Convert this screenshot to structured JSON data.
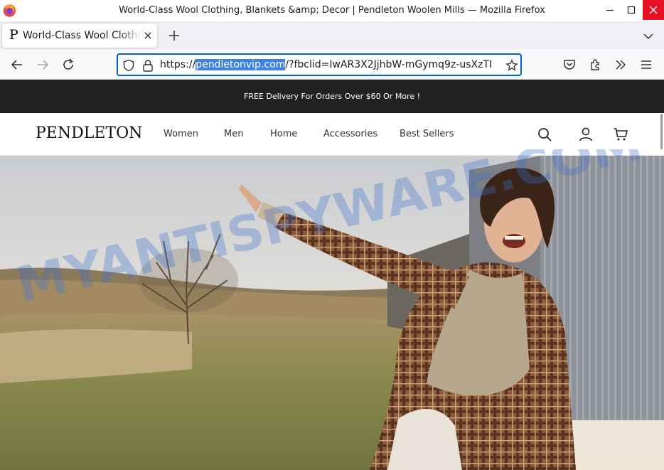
{
  "window": {
    "title": "World-Class Wool Clothing, Blankets &amp; Decor | Pendleton Woolen Mills — Mozilla Firefox"
  },
  "tab": {
    "favicon": "P",
    "title": "World-Class Wool Clothing, Blankets & Decor | Pendleton Woolen Mills"
  },
  "urlbar": {
    "prefix": "https://",
    "domain": "pendletonvip.com",
    "suffix": "/?fbclid=IwAR3X2JjhbW-mGymq9z-usXzTI",
    "selection_color": "#3d83e5"
  },
  "page": {
    "promo": "FREE Delivery For Orders Over $60 Or More !",
    "logo": "PENDLETON",
    "nav": [
      {
        "label": "Women"
      },
      {
        "label": "Men"
      },
      {
        "label": "Home"
      },
      {
        "label": "Accessories"
      },
      {
        "label": "Best Sellers"
      }
    ],
    "header_icons": [
      "search-icon",
      "account-icon",
      "cart-icon"
    ]
  },
  "watermark": "MYANTISPYWARE.COM",
  "colors": {
    "accent": "#0061e0",
    "close_button": "#e81123",
    "promo_bg": "#222222"
  }
}
